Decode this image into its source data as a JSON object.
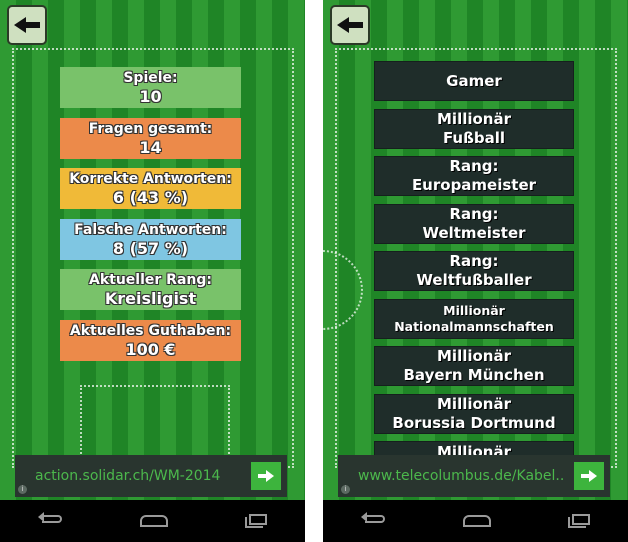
{
  "colors": {
    "field_dark": "#1f8526",
    "field_light": "#2f9a33",
    "stat_green": "#79c26a",
    "stat_orange": "#ec8a4a",
    "stat_yellow": "#f0ba38",
    "stat_blue": "#7fc6e2",
    "menu_bg": "#1f2d2a",
    "ad_text": "#4cb84c"
  },
  "stats_screen": {
    "stats": [
      {
        "label": "Spiele:",
        "value": "10"
      },
      {
        "label": "Fragen gesamt:",
        "value": "14"
      },
      {
        "label": "Korrekte Antworten:",
        "value": "6 (43 %)"
      },
      {
        "label": "Falsche Antworten:",
        "value": "8 (57 %)"
      },
      {
        "label": "Aktueller Rang:",
        "value": "Kreisligist"
      },
      {
        "label": "Aktuelles Guthaben:",
        "value": "100 €"
      }
    ],
    "ad": {
      "text": "action.solidar.ch/WM-2014",
      "info": "i"
    }
  },
  "menu_screen": {
    "items": [
      {
        "line1": "Gamer",
        "line2": ""
      },
      {
        "line1": "Millionär",
        "line2": "Fußball"
      },
      {
        "line1": "Rang:",
        "line2": "Europameister"
      },
      {
        "line1": "Rang:",
        "line2": "Weltmeister"
      },
      {
        "line1": "Rang:",
        "line2": "Weltfußballer"
      },
      {
        "line1": "Millionär",
        "line2": "Nationalmannschaften"
      },
      {
        "line1": "Millionär",
        "line2": "Bayern München"
      },
      {
        "line1": "Millionär",
        "line2": "Borussia Dortmund"
      },
      {
        "line1": "Millionär",
        "line2": ""
      }
    ],
    "ad": {
      "text": "www.telecolumbus.de/Kabel...",
      "info": "i"
    }
  },
  "icons": {
    "back": "back-arrow-icon",
    "go": "arrow-right-icon",
    "nav_back": "nav-back-icon",
    "nav_home": "nav-home-icon",
    "nav_recent": "nav-recent-apps-icon"
  }
}
